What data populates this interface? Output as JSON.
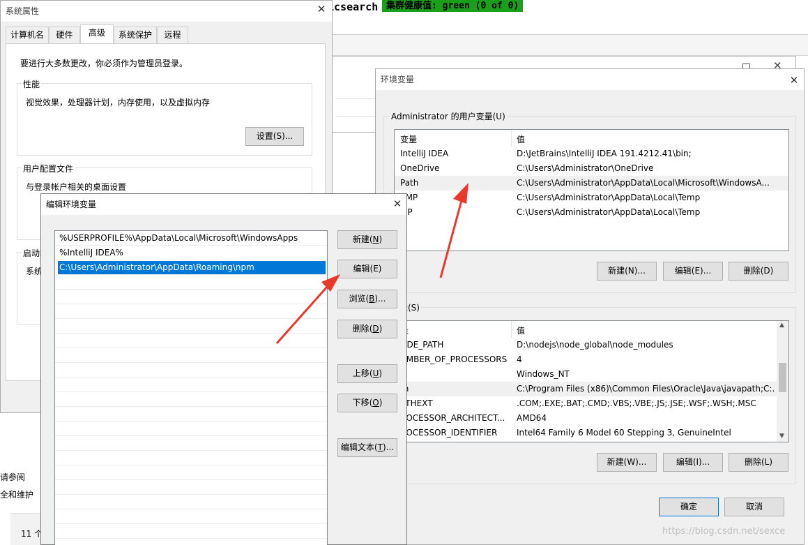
{
  "header": {
    "app_name": "elasticsearch",
    "app_name_visible": "icsearch",
    "health_badge": "集群健康值: green (0 of 0)"
  },
  "colors": {
    "badge_bg": "#1a9f1a",
    "selection": "#0078d7",
    "arrow": "#e8392a",
    "title_text": "#444444"
  },
  "sysprops": {
    "title": "系统属性",
    "tabs": [
      "计算机名",
      "硬件",
      "高级",
      "系统保护",
      "远程"
    ],
    "active_tab": "高级",
    "admin_note": "要进行大多数更改，你必须作为管理员登录。",
    "perf_label": "性能",
    "perf_desc": "视觉效果，处理器计划，内存使用，以及虚拟内存",
    "perf_button": "设置(S)...",
    "profile_label": "用户配置文件",
    "profile_desc": "与登录帐户相关的桌面设置",
    "startup_label": "启动和",
    "startup_desc": "系统"
  },
  "background_fragments": {
    "see_also": "另请参阅",
    "security": "安全和维护",
    "count": "11 个"
  },
  "envvars": {
    "title": "环境变量",
    "user_group_label": "Administrator 的用户变量(U)",
    "columns": [
      "变量",
      "值"
    ],
    "user_vars": [
      {
        "name": "IntelliJ IDEA",
        "value": "D:\\JetBrains\\IntelliJ IDEA 191.4212.41\\bin;"
      },
      {
        "name": "OneDrive",
        "value": "C:\\Users\\Administrator\\OneDrive"
      },
      {
        "name": "Path",
        "value": "C:\\Users\\Administrator\\AppData\\Local\\Microsoft\\WindowsA..."
      },
      {
        "name": "EMP",
        "value": "C:\\Users\\Administrator\\AppData\\Local\\Temp"
      },
      {
        "name": "MP",
        "value": "C:\\Users\\Administrator\\AppData\\Local\\Temp"
      }
    ],
    "user_buttons": [
      "新建(N)...",
      "编辑(E)...",
      "删除(D)"
    ],
    "sys_group_label": "变量(S)",
    "sys_columns": [
      "量",
      "值"
    ],
    "sys_vars": [
      {
        "name": "ODE_PATH",
        "value": "D:\\nodejs\\node_global\\node_modules"
      },
      {
        "name": "UMBER_OF_PROCESSORS",
        "value": "4"
      },
      {
        "name": "S",
        "value": "Windows_NT"
      },
      {
        "name": "th",
        "value": "C:\\Program Files (x86)\\Common Files\\Oracle\\Java\\javapath;C:..."
      },
      {
        "name": "ATHEXT",
        "value": ".COM;.EXE;.BAT;.CMD;.VBS;.VBE;.JS;.JSE;.WSF;.WSH;.MSC"
      },
      {
        "name": "ROCESSOR_ARCHITECT...",
        "value": "AMD64"
      },
      {
        "name": "ROCESSOR_IDENTIFIER",
        "value": "Intel64 Family 6 Model 60 Stepping 3, GenuineIntel"
      }
    ],
    "sys_buttons": [
      "新建(W)...",
      "编辑(I)...",
      "删除(L)"
    ],
    "ok": "确定",
    "cancel": "取消"
  },
  "editvar": {
    "title": "编辑环境变量",
    "entries": [
      "%USERPROFILE%\\AppData\\Local\\Microsoft\\WindowsApps",
      "%IntelliJ IDEA%",
      "C:\\Users\\Administrator\\AppData\\Roaming\\npm"
    ],
    "selected_index": 2,
    "buttons": {
      "new": {
        "text": "新建(",
        "key": "N",
        "tail": ")"
      },
      "edit": "编辑(E)",
      "browse": {
        "text": "浏览(",
        "key": "B",
        "tail": ")..."
      },
      "delete": {
        "text": "删除(",
        "key": "D",
        "tail": ")"
      },
      "up": {
        "text": "上移(",
        "key": "U",
        "tail": ")"
      },
      "down": {
        "text": "下移(",
        "key": "O",
        "tail": ")"
      },
      "edit_text": {
        "text": "编辑文本(",
        "key": "T",
        "tail": ")..."
      }
    }
  },
  "watermark": "https://blog.csdn.net/sexce"
}
